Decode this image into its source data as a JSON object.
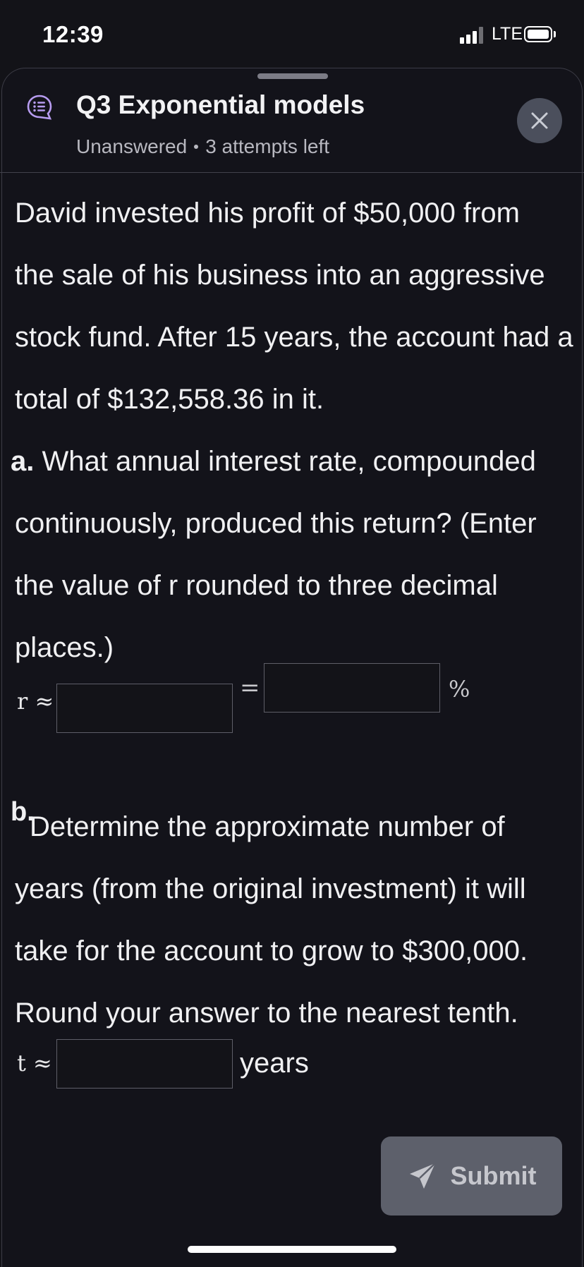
{
  "status_bar": {
    "time": "12:39",
    "network": "LTE"
  },
  "header": {
    "icon": "question-list-icon",
    "title": "Q3 Exponential models",
    "status": "Unanswered",
    "attempts": "3 attempts left",
    "close_icon": "close-icon"
  },
  "question": {
    "intro_lines": [
      "David invested his profit of $50,000 from",
      "the sale of his business into an aggressive",
      "stock fund. After 15 years, the account had a",
      "total of $132,558.36 in it."
    ],
    "part_a": {
      "label": "a.",
      "lines": [
        " What annual interest rate, compounded",
        "continuously, produced this return? (Enter",
        "the value of r rounded to three decimal",
        "places.)"
      ],
      "var_label": "r ≈",
      "equals": "=",
      "percent": "%",
      "r_value": "",
      "percent_value": ""
    },
    "part_b": {
      "label": "b.",
      "lines": [
        " Determine the approximate number of",
        "years (from the original investment) it will",
        "take for the account to grow to $300,000.",
        "Round your answer to the nearest tenth."
      ],
      "var_label": "t ≈",
      "unit": "years",
      "t_value": ""
    }
  },
  "footer": {
    "submit_label": "Submit",
    "submit_icon": "send-icon"
  },
  "colors": {
    "background": "#131318",
    "accent_icon": "#b79cf0",
    "submit_disabled": "#5d606b"
  }
}
